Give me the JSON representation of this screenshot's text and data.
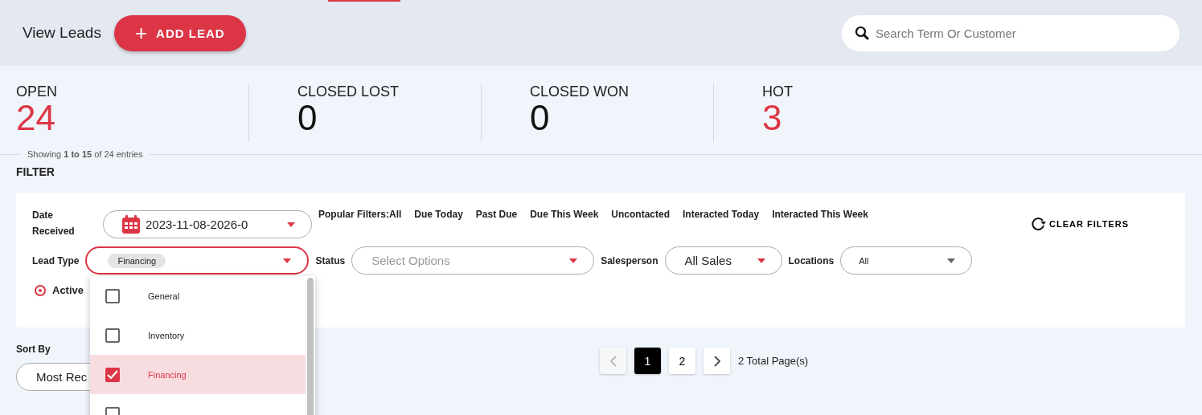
{
  "header": {
    "title": "View Leads",
    "add_button": {
      "icon": "+",
      "label": "ADD LEAD"
    },
    "search": {
      "placeholder": "Search Term Or Customer"
    }
  },
  "stats": [
    {
      "label": "OPEN",
      "value": "24",
      "highlight": true
    },
    {
      "label": "CLOSED LOST",
      "value": "0",
      "highlight": false
    },
    {
      "label": "CLOSED WON",
      "value": "0",
      "highlight": false
    },
    {
      "label": "HOT",
      "value": "3",
      "highlight": true
    }
  ],
  "showing": "Showing **1 to 15** of  24 entries",
  "filter": {
    "title": "FILTER",
    "date_label": "Date Received",
    "date_value": "2023-11-08-2026-0",
    "popular_label": "Popular Filters:All",
    "popular": [
      "Due Today",
      "Past Due",
      "Due This Week",
      "Uncontacted",
      "Interacted Today",
      "Interacted This Week"
    ],
    "clear_label": "CLEAR FILTERS",
    "lead_type_label": "Lead Type",
    "lead_type_chip": "Financing",
    "status_label": "Status",
    "status_placeholder": "Select Options",
    "salesperson_label": "Salesperson",
    "salesperson_value": "All Sales",
    "locations_label": "Locations",
    "locations_value": "All",
    "active_radio": {
      "label": "Active",
      "selected": true
    },
    "lead_type_options": [
      {
        "label": "General",
        "checked": false
      },
      {
        "label": "Inventory",
        "checked": false
      },
      {
        "label": "Financing",
        "checked": true
      },
      {
        "checked": false
      }
    ]
  },
  "sort": {
    "label": "Sort By",
    "value": "Most Rec"
  },
  "pagination": {
    "pages": [
      {
        "label": "1",
        "selected": true
      },
      {
        "label": "2",
        "selected": false
      }
    ],
    "total": "2 Total Page(s)"
  }
}
